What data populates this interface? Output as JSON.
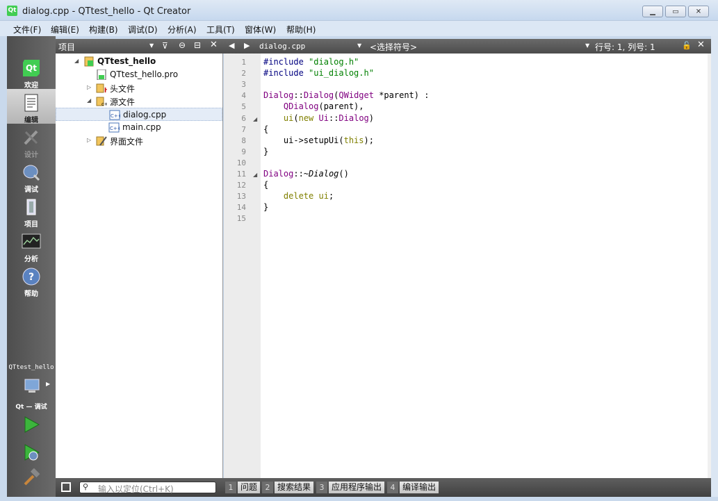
{
  "window": {
    "title": "dialog.cpp - QTtest_hello - Qt Creator"
  },
  "menu": [
    "文件(F)",
    "编辑(E)",
    "构建(B)",
    "调试(D)",
    "分析(A)",
    "工具(T)",
    "窗体(W)",
    "帮助(H)"
  ],
  "modes": [
    {
      "label": "欢迎",
      "icon": "qt-logo-icon"
    },
    {
      "label": "编辑",
      "icon": "edit-document-icon"
    },
    {
      "label": "设计",
      "icon": "design-tools-icon"
    },
    {
      "label": "调试",
      "icon": "debug-bug-icon"
    },
    {
      "label": "项目",
      "icon": "project-folder-icon"
    },
    {
      "label": "分析",
      "icon": "analyze-screen-icon"
    },
    {
      "label": "帮助",
      "icon": "help-icon"
    }
  ],
  "target": {
    "project": "QTtest_hello",
    "kit": "Qt  — 调试"
  },
  "project_panel": {
    "header": "项目"
  },
  "tree": [
    {
      "label": "QTtest_hello",
      "bold": true,
      "level": 0,
      "arrow": "◢",
      "icon": "qt-project-icon"
    },
    {
      "label": "QTtest_hello.pro",
      "level": 1,
      "arrow": "",
      "icon": "pro-file-icon"
    },
    {
      "label": "头文件",
      "level": 1,
      "arrow": "▷",
      "icon": "header-folder-icon"
    },
    {
      "label": "源文件",
      "level": 1,
      "arrow": "◢",
      "icon": "source-folder-icon"
    },
    {
      "label": "dialog.cpp",
      "level": 2,
      "arrow": "",
      "icon": "cpp-file-icon",
      "selected": true
    },
    {
      "label": "main.cpp",
      "level": 2,
      "arrow": "",
      "icon": "cpp-file-icon"
    },
    {
      "label": "界面文件",
      "level": 1,
      "arrow": "▷",
      "icon": "form-folder-icon"
    }
  ],
  "editor": {
    "file": "dialog.cpp",
    "symbol": "<选择符号>",
    "position": "行号: 1, 列号: 1",
    "lines": [
      [
        {
          "t": "#include ",
          "c": "k-pre"
        },
        {
          "t": "\"dialog.h\"",
          "c": "k-str"
        }
      ],
      [
        {
          "t": "#include ",
          "c": "k-pre"
        },
        {
          "t": "\"ui_dialog.h\"",
          "c": "k-str"
        }
      ],
      [],
      [
        {
          "t": "Dialog",
          "c": "k-type"
        },
        {
          "t": "::",
          "c": ""
        },
        {
          "t": "Dialog",
          "c": "k-type"
        },
        {
          "t": "(",
          "c": ""
        },
        {
          "t": "QWidget",
          "c": "k-type"
        },
        {
          "t": " *parent) :",
          "c": ""
        }
      ],
      [
        {
          "t": "    ",
          "c": ""
        },
        {
          "t": "QDialog",
          "c": "k-type"
        },
        {
          "t": "(parent),",
          "c": ""
        }
      ],
      [
        {
          "t": "    ",
          "c": ""
        },
        {
          "t": "ui",
          "c": "k-kw"
        },
        {
          "t": "(",
          "c": ""
        },
        {
          "t": "new",
          "c": "k-kw"
        },
        {
          "t": " ",
          "c": ""
        },
        {
          "t": "Ui",
          "c": "k-type"
        },
        {
          "t": "::",
          "c": ""
        },
        {
          "t": "Dialog",
          "c": "k-type"
        },
        {
          "t": ")",
          "c": ""
        }
      ],
      [
        {
          "t": "{",
          "c": ""
        }
      ],
      [
        {
          "t": "    ui->setupUi(",
          "c": ""
        },
        {
          "t": "this",
          "c": "k-kw"
        },
        {
          "t": ");",
          "c": ""
        }
      ],
      [
        {
          "t": "}",
          "c": ""
        }
      ],
      [],
      [
        {
          "t": "Dialog",
          "c": "k-type"
        },
        {
          "t": "::~",
          "c": ""
        },
        {
          "t": "Dialog",
          "c": "k-it"
        },
        {
          "t": "()",
          "c": ""
        }
      ],
      [
        {
          "t": "{",
          "c": ""
        }
      ],
      [
        {
          "t": "    ",
          "c": ""
        },
        {
          "t": "delete",
          "c": "k-kw"
        },
        {
          "t": " ",
          "c": ""
        },
        {
          "t": "ui",
          "c": "k-kw"
        },
        {
          "t": ";",
          "c": ""
        }
      ],
      [
        {
          "t": "}",
          "c": ""
        }
      ],
      []
    ],
    "folds": [
      6,
      11
    ]
  },
  "locator": {
    "placeholder": "输入以定位(Ctrl+K)"
  },
  "output_tabs": [
    {
      "num": "1",
      "label": "问题"
    },
    {
      "num": "2",
      "label": "搜索结果"
    },
    {
      "num": "3",
      "label": "应用程序输出"
    },
    {
      "num": "4",
      "label": "编译输出"
    }
  ]
}
